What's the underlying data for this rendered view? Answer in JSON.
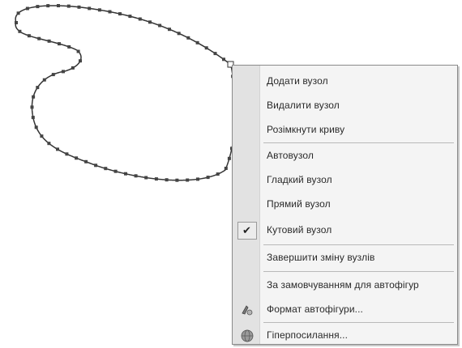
{
  "menu": {
    "items": [
      {
        "label": "Додати вузол"
      },
      {
        "label": "Видалити вузол"
      },
      {
        "label": "Розімкнути криву"
      },
      {
        "label": "Автовузол"
      },
      {
        "label": "Гладкий вузол"
      },
      {
        "label": "Прямий вузол"
      },
      {
        "label": "Кутовий вузол",
        "checked": true,
        "check_glyph": "✔"
      },
      {
        "label": "Завершити зміну вузлів"
      },
      {
        "label": "За замовчуванням для автофігур"
      },
      {
        "label": "Формат автофігури...",
        "icon": "format-shape-icon"
      },
      {
        "label": "Гіперпосилання...",
        "icon": "hyperlink-globe-icon"
      }
    ]
  },
  "colors": {
    "menu_background": "#f4f4f4",
    "icon_strip": "#e2e2e2",
    "curve_stroke": "#333333",
    "node_fill": "#444444"
  }
}
